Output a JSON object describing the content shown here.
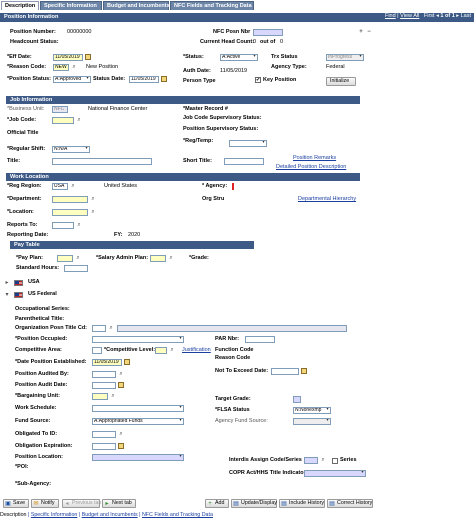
{
  "tabs": [
    {
      "label": "Description"
    },
    {
      "label": "Specific Information"
    },
    {
      "label": "Budget and Incumbents"
    },
    {
      "label": "NFC Fields and Tracking Data"
    }
  ],
  "position_info": {
    "header": "Position Information",
    "nav": {
      "find": "Find",
      "view_all": "View All",
      "first": "First",
      "range": "1 of 1",
      "last": "Last"
    },
    "position_number_label": "Position Number:",
    "position_number": "00000000",
    "nfc_posn_nbr_label": "NFC Posn Nbr",
    "nfc_posn_nbr": "",
    "headcount_status_label": "Headcount Status:",
    "current_head_count_label": "Current Head Count:",
    "current_head_count": "0",
    "out_of_label": "out of",
    "out_of": "0",
    "eff_date_label": "*Eff Date:",
    "eff_date": "11/05/2019",
    "status_label": "*Status:",
    "status": "A:Active",
    "trx_status_label": "Trx Status",
    "trx_status": "InProgress",
    "reason_code_label": "*Reason Code:",
    "reason_code": "NEW",
    "reason_desc": "New Position",
    "agency_type_label": "Agency Type:",
    "agency_type": "Federal",
    "auth_date_label": "Auth Date:",
    "auth_date": "11/05/2019",
    "position_status_label": "*Position Status:",
    "position_status": "A:Approved",
    "status_date_label": "Status Date:",
    "status_date": "11/05/2019",
    "person_type_label": "Person Type",
    "key_position_label": "Key Position",
    "key_position": "✔",
    "initialize_label": "Initialize"
  },
  "job_info": {
    "header": "Job Information",
    "business_unit_label": "*Business Unit:",
    "business_unit": "NFC",
    "business_unit_desc": "National Finance Center",
    "master_record_label": "*Master Record #",
    "job_code_label": "*Job Code:",
    "job_code_supervisory_label": "Job Code Supervisory Status:",
    "position_supervisory_label": "Position Supervisory Status:",
    "official_title_label": "Official Title",
    "reg_temp_label": "*Reg/Temp:",
    "regular_shift_label": "*Regular Shift:",
    "regular_shift": "N:N/A",
    "title_label": "Title:",
    "short_title_label": "Short Title:",
    "position_remarks_link": "Position Remarks",
    "detailed_position_desc_link": "Detailed Position Description"
  },
  "work_location": {
    "header": "Work Location",
    "reg_region_label": "*Reg Region:",
    "reg_region": "USA",
    "reg_region_desc": "United States",
    "agency_label": "* Agency:",
    "department_label": "*Department:",
    "org_stru_label": "Org Stru",
    "departmental_hierarchy_link": "Departmental Hierarchy",
    "location_label": "*Location:",
    "reports_to_label": "Reports To:",
    "reporting_date_label": "Reporting Date:",
    "fy_label": "FY:",
    "fy": "2020"
  },
  "pay_table": {
    "header": "Pay Table",
    "pay_plan_label": "*Pay Plan:",
    "salary_admin_plan_label": "*Salary Admin Plan:",
    "grade_label": "*Grade:",
    "standard_hours_label": "Standard Hours:"
  },
  "usa_label": "USA",
  "us_federal_label": "US Federal",
  "federal": {
    "occupational_series_label": "Occupational Series:",
    "parenthetical_title_label": "Parenthetical Title:",
    "org_posn_title_cd_label": "Organization Posn Title Cd:",
    "position_occupied_label": "*Position Occupied:",
    "par_nbr_label": "PAR Nbr:",
    "competitive_area_label": "Competitive Area:",
    "competitive_level_label": "*Competitive Level:",
    "justification_link": "Justification",
    "function_code_label": "Function Code",
    "reason_code_label": "Reason Code",
    "date_position_established_label": "*Date Position Established:",
    "date_position_established": "11/05/2019",
    "position_audited_by_label": "Position Audited By:",
    "not_to_exceed_label": "Not To Exceed Date:",
    "position_audit_date_label": "Position Audit Date:",
    "bargaining_unit_label": "*Bargaining Unit:",
    "target_grade_label": "Target Grade:",
    "work_schedule_label": "Work Schedule:",
    "flsa_status_label": "*FLSA Status",
    "flsa_status": "N:Nonexmp",
    "fund_source_label": "Fund Source:",
    "fund_source": "A:Appropriated Funds",
    "agency_fund_source_label": "Agency Fund Source:",
    "obligated_to_id_label": "Obligated To ID:",
    "obligation_expiration_label": "Obligation Expiration:",
    "position_location_label": "Position Location:",
    "interdis_label": "Interdis Assign Code/Series",
    "series_label": "Series",
    "poi_label": "*POI:",
    "copr_label": "COPR Act/HHS Title Indicator",
    "sub_agency_label": "*Sub-Agency:"
  },
  "buttons": {
    "save": "Save",
    "notify": "Notify",
    "previous_tab": "Previous tab",
    "next_tab": "Next tab",
    "add": "Add",
    "update_display": "Update/Display",
    "include_history": "Include History",
    "correct_history": "Correct History"
  },
  "bottom_tabs": [
    "Description",
    "Specific Information",
    "Budget and Incumbents",
    "NFC Fields and Tracking Data"
  ],
  "colors": {
    "section_bg": "#3d5a86",
    "link": "#1b3fa0",
    "required_field": "#ffffc0"
  }
}
